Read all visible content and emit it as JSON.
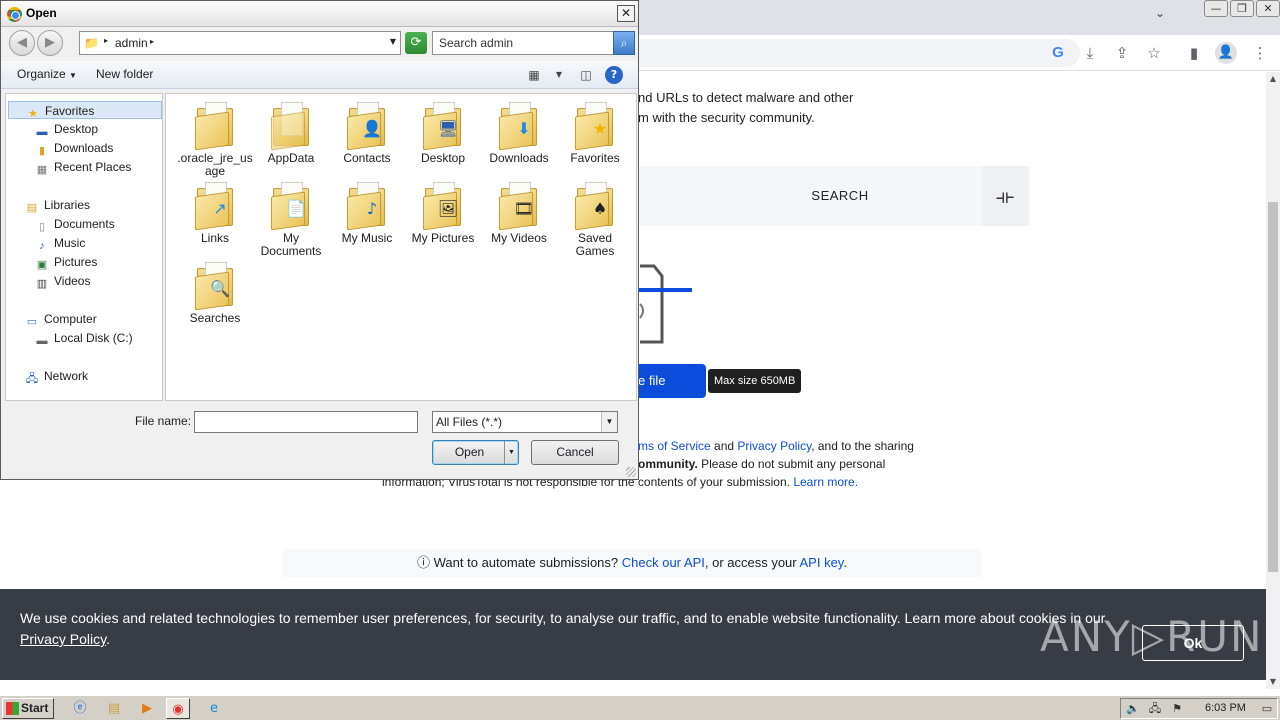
{
  "browser": {
    "window_controls": [
      "—",
      "❐",
      "✕"
    ],
    "tab_search_icon": "chevron-down-icon",
    "toolbar_icons": [
      "google-icon",
      "download-icon",
      "share-icon",
      "bookmark-star-icon",
      "side-panel-icon",
      "profile-icon",
      "menu-icon"
    ]
  },
  "page": {
    "intro_line1": "nd URLs to detect malware and other",
    "intro_line2": "m with the security community.",
    "search_label": "SEARCH",
    "choose_file_label": "e file",
    "max_size_tooltip": "Max size 650MB",
    "terms_line1_link1": "ms of Service",
    "terms_line1_and": " and ",
    "terms_line1_link2": "Privacy Policy",
    "terms_line1_rest": ", and to the sharing",
    "terms_line2_bold": "ommunity.",
    "terms_line2_rest": " Please do not submit any personal",
    "terms_line3": "information; VirusTotal is not responsible for the contents of your submission. ",
    "terms_line3_link": "Learn more.",
    "automate_prefix": "Want to automate submissions? ",
    "automate_link1": "Check our API",
    "automate_mid": ", or access your ",
    "automate_link2": "API key",
    "automate_suffix": "."
  },
  "cookie_banner": {
    "text": "We use cookies and related technologies to remember user preferences, for security, to analyse our traffic, and to enable website functionality. Learn more about cookies in our ",
    "link": "Privacy Policy",
    "text_end": ".",
    "ok_label": "Ok",
    "watermark": "ANY▷RUN"
  },
  "dialog": {
    "title": "Open",
    "close_glyph": "✕",
    "address": "admin",
    "search_placeholder": "Search admin",
    "organize_label": "Organize",
    "new_folder_label": "New folder",
    "nav_tree": {
      "favorites": "Favorites",
      "desktop": "Desktop",
      "downloads": "Downloads",
      "recent_places": "Recent Places",
      "libraries": "Libraries",
      "documents": "Documents",
      "music": "Music",
      "pictures": "Pictures",
      "videos": "Videos",
      "computer": "Computer",
      "local_disk": "Local Disk (C:)",
      "network": "Network"
    },
    "files": [
      {
        "label": ".oracle_jre_usage",
        "overlay": ""
      },
      {
        "label": "AppData",
        "overlay": ""
      },
      {
        "label": "Contacts",
        "overlay": "👤"
      },
      {
        "label": "Desktop",
        "overlay": "🖥"
      },
      {
        "label": "Downloads",
        "overlay": "⬇"
      },
      {
        "label": "Favorites",
        "overlay": "★"
      },
      {
        "label": "Links",
        "overlay": "↗"
      },
      {
        "label": "My Documents",
        "overlay": "📄"
      },
      {
        "label": "My Music",
        "overlay": "♪"
      },
      {
        "label": "My Pictures",
        "overlay": "🖼"
      },
      {
        "label": "My Videos",
        "overlay": "🎞"
      },
      {
        "label": "Saved Games",
        "overlay": "♠"
      },
      {
        "label": "Searches",
        "overlay": "🔍"
      }
    ],
    "file_name_label": "File name:",
    "file_name_value": "",
    "filter_value": "All Files (*.*)",
    "open_label": "Open",
    "cancel_label": "Cancel"
  },
  "taskbar": {
    "start_label": "Start",
    "clock": "6:03 PM"
  }
}
